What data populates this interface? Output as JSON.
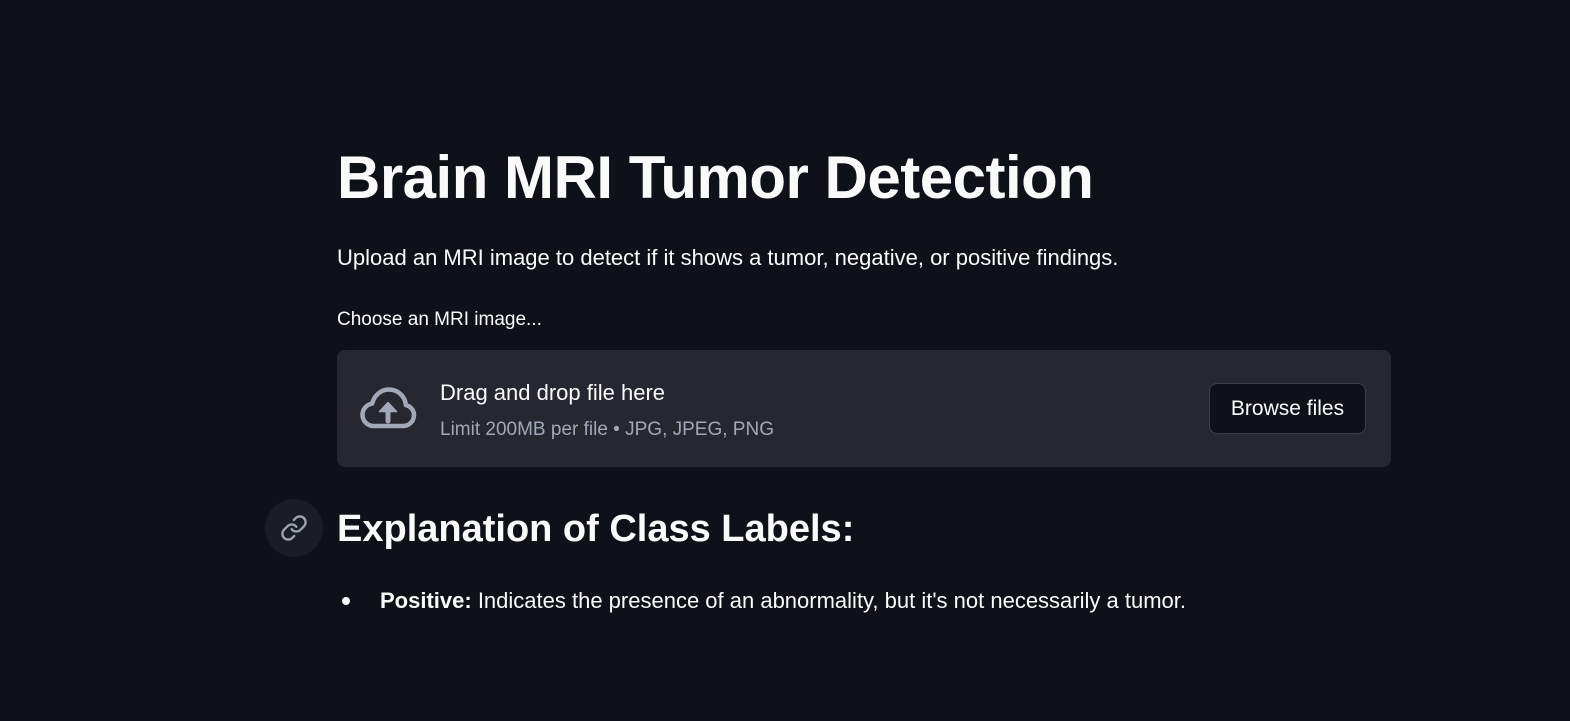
{
  "page": {
    "title": "Brain MRI Tumor Detection",
    "subtitle": "Upload an MRI image to detect if it shows a tumor, negative, or positive findings."
  },
  "uploader": {
    "label": "Choose an MRI image...",
    "drop_text": "Drag and drop file here",
    "limit_text": "Limit 200MB per file • JPG, JPEG, PNG",
    "browse_label": "Browse files",
    "icon": "cloud-upload-icon"
  },
  "explanation": {
    "heading": "Explanation of Class Labels:",
    "anchor_icon": "link-icon",
    "items": [
      {
        "term": "Positive:",
        "description": " Indicates the presence of an abnormality, but it's not necessarily a tumor."
      }
    ]
  },
  "colors": {
    "background": "#0e1117",
    "dropzone": "#262730",
    "text": "#fafafa",
    "muted_text": "#a3a8b8"
  }
}
